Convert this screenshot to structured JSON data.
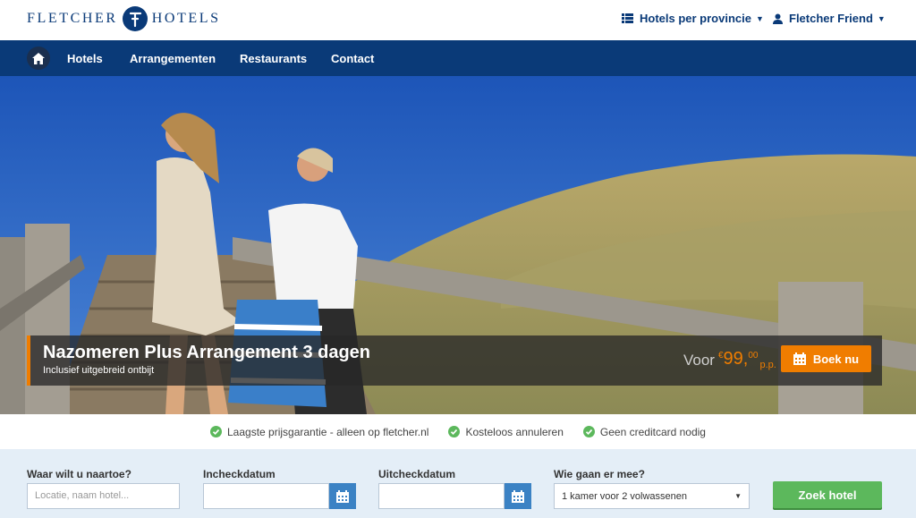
{
  "brand": {
    "name_left": "FLETCHER",
    "name_right": "HOTELS",
    "primary_color": "#0a3a78",
    "accent_color": "#f07d00"
  },
  "top_menu": {
    "provinces": "Hotels per provincie",
    "friend": "Fletcher Friend"
  },
  "nav": {
    "items": [
      "Hotels",
      "Arrangementen",
      "Restaurants",
      "Contact"
    ]
  },
  "promo": {
    "title": "Nazomeren Plus Arrangement 3 dagen",
    "subtitle": "Inclusief uitgebreid ontbijt",
    "price_prefix": "Voor",
    "currency": "€",
    "price_main": "99,",
    "price_cents": "00",
    "price_suffix": "p.p.",
    "book_label": "Boek nu"
  },
  "usps": [
    "Laagste prijsgarantie - alleen op fletcher.nl",
    "Kosteloos annuleren",
    "Geen creditcard nodig"
  ],
  "search": {
    "destination_label": "Waar wilt u naartoe?",
    "destination_placeholder": "Locatie, naam hotel...",
    "checkin_label": "Incheckdatum",
    "checkout_label": "Uitcheckdatum",
    "guests_label": "Wie gaan er mee?",
    "guests_value": "1 kamer voor 2 volwassenen",
    "submit_label": "Zoek hotel"
  }
}
